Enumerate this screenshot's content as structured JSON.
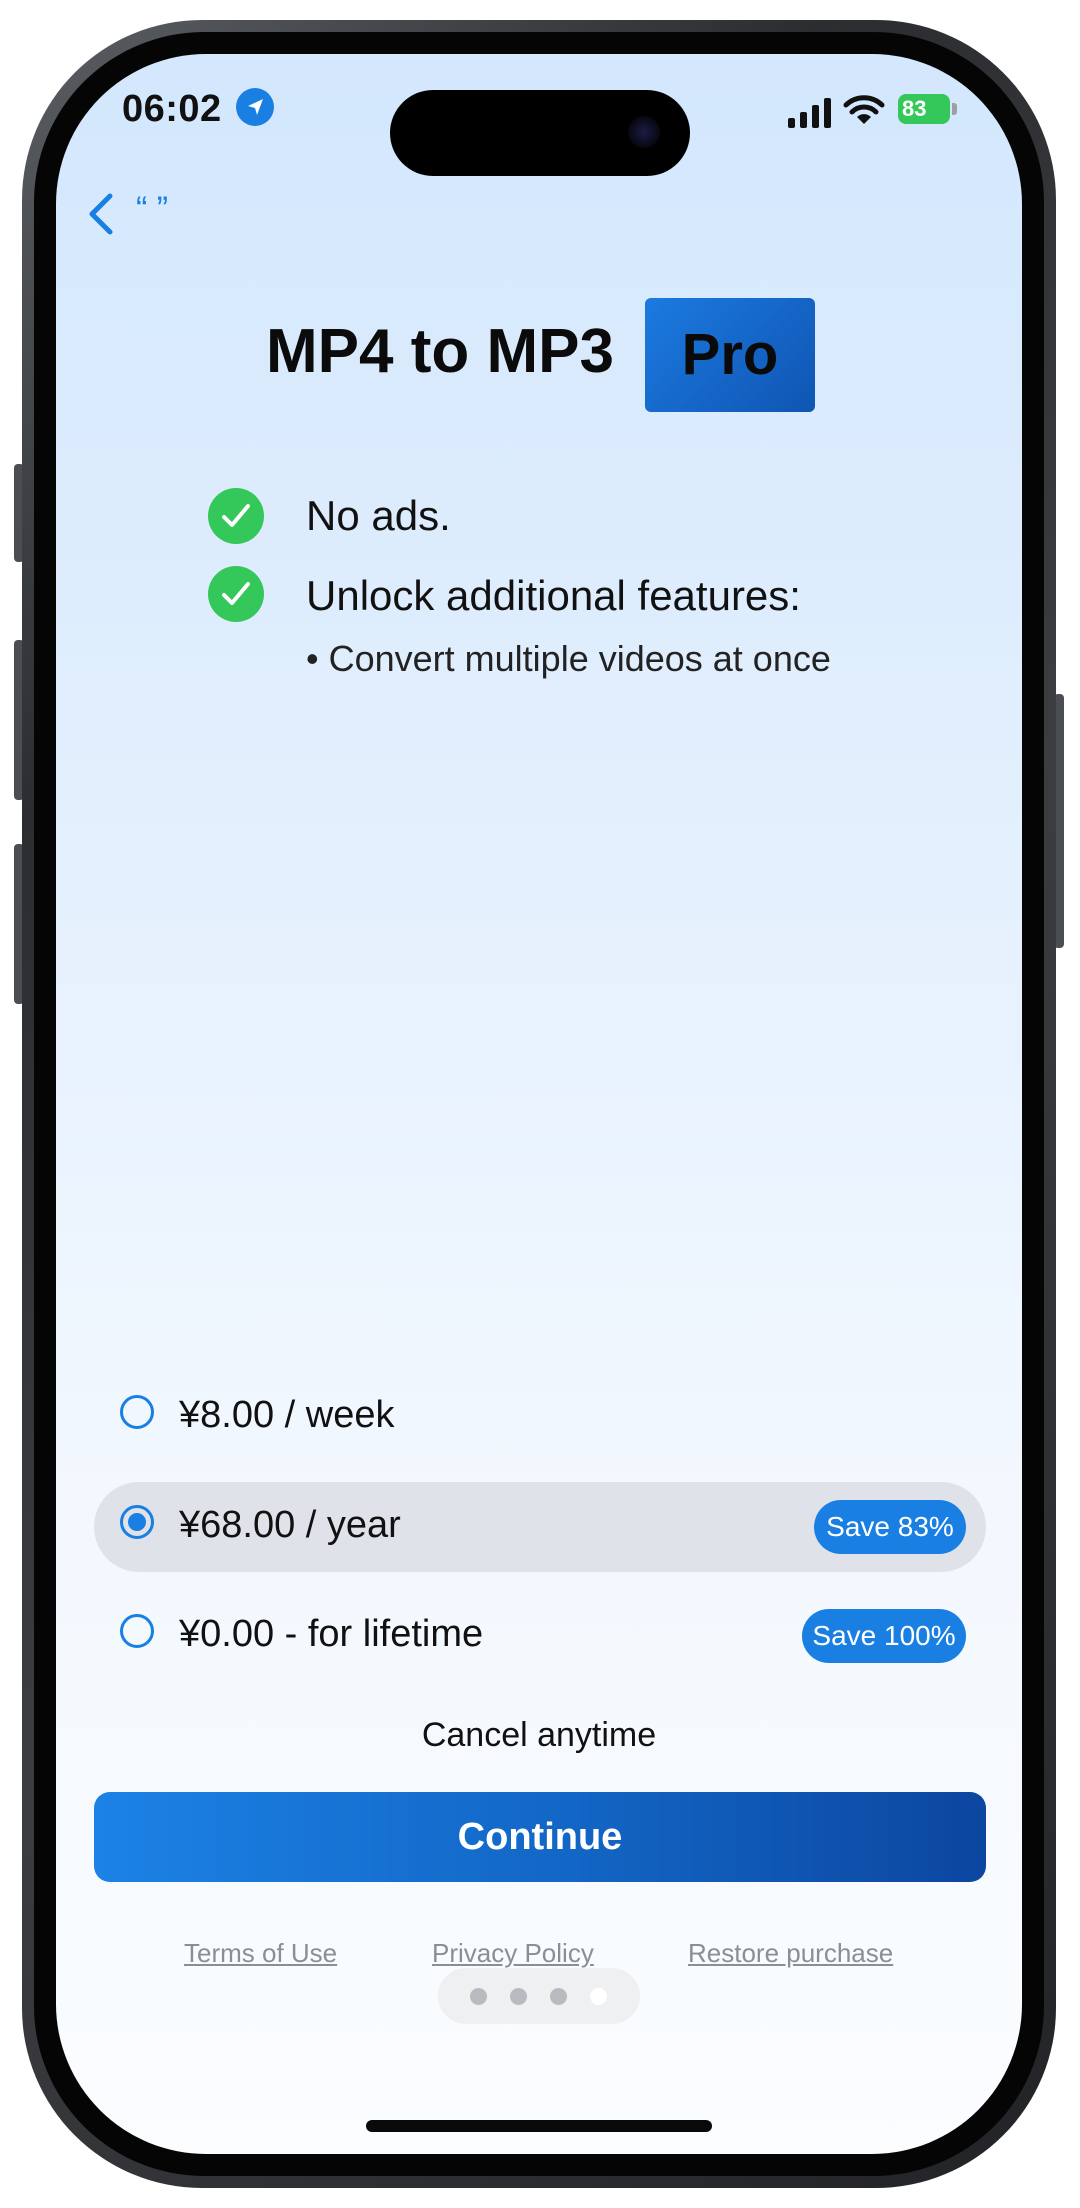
{
  "status_bar": {
    "time": "06:02",
    "battery": "83"
  },
  "nav": {
    "back_label": "“ ”"
  },
  "header": {
    "title": "MP4 to MP3",
    "badge": "Pro"
  },
  "features": [
    {
      "text": "No ads."
    },
    {
      "text": "Unlock additional features:"
    }
  ],
  "sub_features": [
    "• Convert multiple videos at once"
  ],
  "plans": [
    {
      "label": "¥8.00 / week",
      "save": "",
      "selected": false
    },
    {
      "label": "¥68.00 / year",
      "save": "Save 83%",
      "selected": true
    },
    {
      "label": "¥0.00 - for lifetime",
      "save": "Save 100%",
      "selected": false
    }
  ],
  "cancel_text": "Cancel anytime",
  "continue_label": "Continue",
  "footer": {
    "terms": "Terms of Use",
    "privacy": "Privacy Policy",
    "restore": "Restore purchase"
  },
  "page_indicator": {
    "count": 4,
    "active_index": 3
  },
  "colors": {
    "accent": "#1a7fe3",
    "check_green": "#34c759",
    "selected_row": "#dfe3e9"
  }
}
